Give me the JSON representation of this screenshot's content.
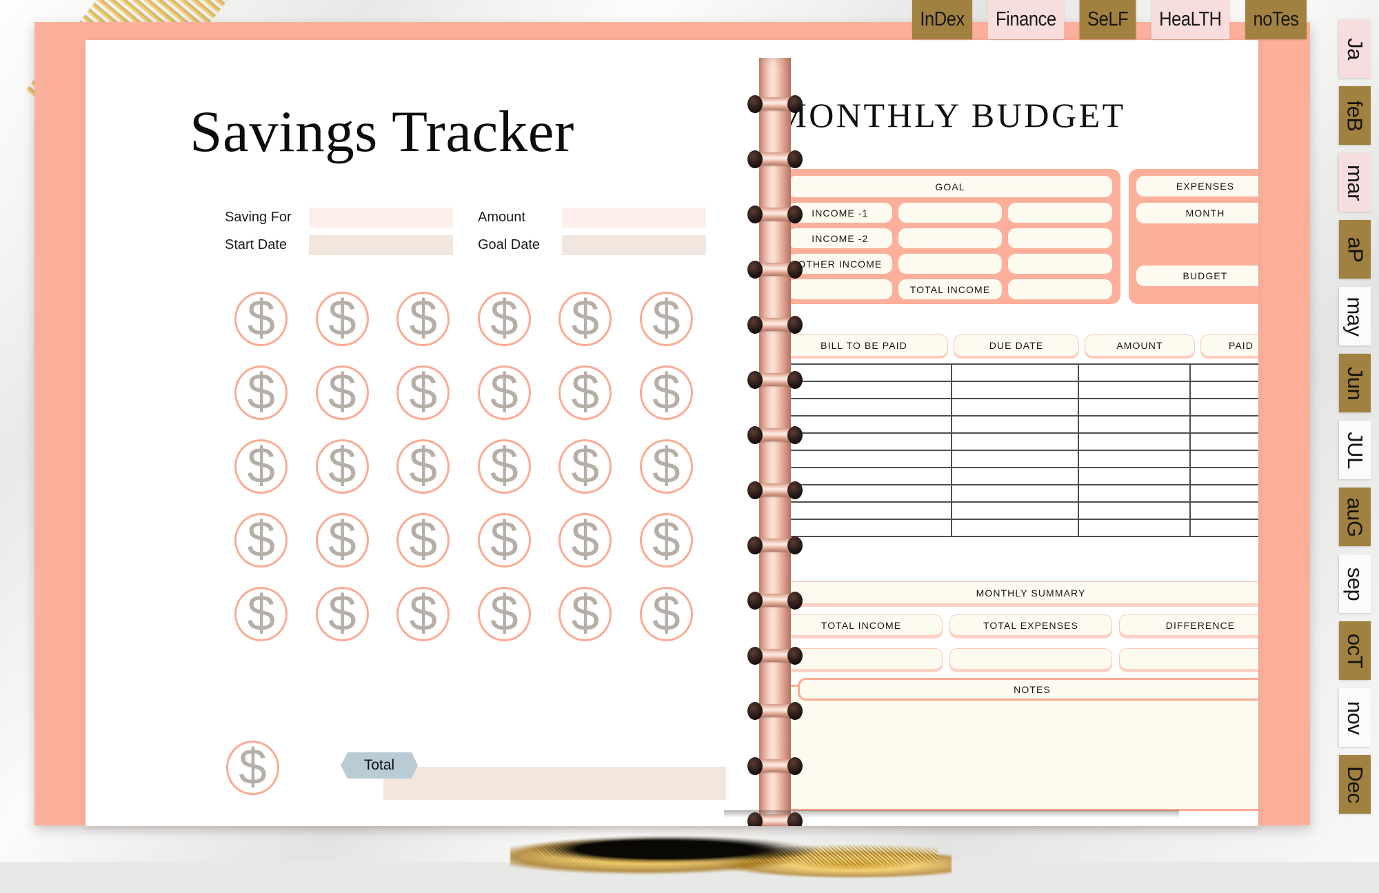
{
  "top_tabs": [
    {
      "label": "InDex",
      "style": "brown"
    },
    {
      "label": "Finance",
      "style": "pink"
    },
    {
      "label": "SeLF",
      "style": "brown"
    },
    {
      "label": "HeaLTH",
      "style": "pink"
    },
    {
      "label": "noTes",
      "style": "brown"
    }
  ],
  "month_tabs": [
    {
      "label": "Ja",
      "style": "pink"
    },
    {
      "label": "feB",
      "style": "brown"
    },
    {
      "label": "mar",
      "style": "pink"
    },
    {
      "label": "aP",
      "style": "brown"
    },
    {
      "label": "may",
      "style": "white"
    },
    {
      "label": "Jun",
      "style": "brown"
    },
    {
      "label": "JUL",
      "style": "white"
    },
    {
      "label": "auG",
      "style": "brown"
    },
    {
      "label": "sep",
      "style": "white"
    },
    {
      "label": "ocT",
      "style": "brown"
    },
    {
      "label": "nov",
      "style": "white"
    },
    {
      "label": "Dec",
      "style": "brown"
    }
  ],
  "left_page": {
    "title": "Savings Tracker",
    "form": {
      "saving_for_label": "Saving For",
      "saving_for_value": "",
      "amount_label": "Amount",
      "amount_value": "",
      "start_date_label": "Start Date",
      "start_date_value": "",
      "goal_date_label": "Goal Date",
      "goal_date_value": ""
    },
    "coin_symbol": "$",
    "coin_rows": 5,
    "coin_cols": 6,
    "coin_count": 30,
    "total": {
      "badge_label": "Total",
      "value": ""
    }
  },
  "right_page": {
    "title": "MONTHLY BUDGET",
    "income_panel": {
      "goal_label": "GOAL",
      "goal_value": "",
      "rows": [
        {
          "label": "INCOME -1",
          "value_mid": "",
          "value_right": ""
        },
        {
          "label": "INCOME -2",
          "value_mid": "",
          "value_right": ""
        },
        {
          "label": "OTHER INCOME",
          "value_mid": "",
          "value_right": ""
        }
      ],
      "total_row": {
        "value_left": "",
        "label": "TOTAL INCOME",
        "value_right": ""
      }
    },
    "expenses_panel": {
      "expenses_label": "EXPENSES",
      "month_label": "MONTH",
      "month_value": "",
      "budget_label": "BUDGET",
      "budget_value": ""
    },
    "bills_table": {
      "columns": [
        "BILL TO BE PAID",
        "DUE DATE",
        "AMOUNT",
        "PAID"
      ],
      "row_count": 10,
      "rows": [
        [
          "",
          "",
          "",
          ""
        ],
        [
          "",
          "",
          "",
          ""
        ],
        [
          "",
          "",
          "",
          ""
        ],
        [
          "",
          "",
          "",
          ""
        ],
        [
          "",
          "",
          "",
          ""
        ],
        [
          "",
          "",
          "",
          ""
        ],
        [
          "",
          "",
          "",
          ""
        ],
        [
          "",
          "",
          "",
          ""
        ],
        [
          "",
          "",
          "",
          ""
        ],
        [
          "",
          "",
          "",
          ""
        ]
      ]
    },
    "monthly_summary": {
      "heading": "MONTHLY SUMMARY",
      "items": [
        {
          "label": "TOTAL INCOME",
          "value": ""
        },
        {
          "label": "TOTAL EXPENSES",
          "value": ""
        },
        {
          "label": "DIFFERENCE",
          "value": ""
        }
      ]
    },
    "notes": {
      "heading": "NOTES",
      "content": ""
    }
  },
  "colors": {
    "cover_salmon": "#fcaf9a",
    "pill_cream": "#fdfaef",
    "field_pink": "#fdeeec",
    "field_beige": "#f1e7de",
    "coin_gray": "#b5afa8",
    "badge_blue": "#b9ccd5",
    "tab_brown": "#a1813f",
    "tab_pink": "#f5dedd"
  }
}
